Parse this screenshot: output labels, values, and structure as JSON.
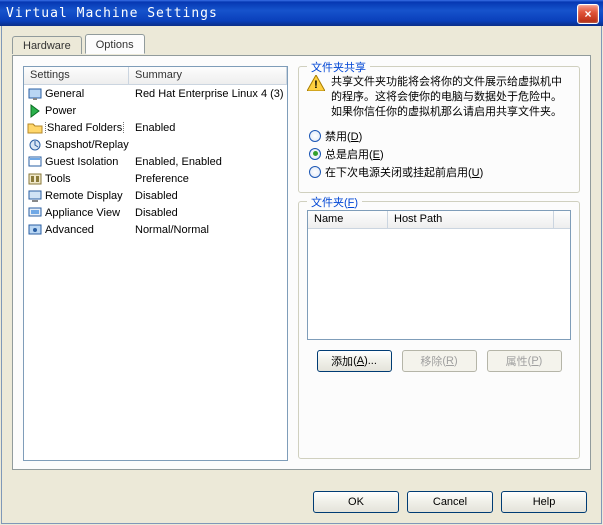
{
  "window": {
    "title": "Virtual Machine Settings",
    "close_icon": "×"
  },
  "tabs": {
    "hardware": "Hardware",
    "options": "Options",
    "active": "options"
  },
  "settings_list": {
    "header_settings": "Settings",
    "header_summary": "Summary",
    "rows": [
      {
        "icon": "general-icon",
        "label": "General",
        "summary": "Red Hat Enterprise Linux 4 (3)",
        "selected": false
      },
      {
        "icon": "power-icon",
        "label": "Power",
        "summary": "",
        "selected": false
      },
      {
        "icon": "folder-icon",
        "label": "Shared Folders",
        "summary": "Enabled",
        "selected": true
      },
      {
        "icon": "snapshot-icon",
        "label": "Snapshot/Replay",
        "summary": "",
        "selected": false
      },
      {
        "icon": "guest-isolation-icon",
        "label": "Guest Isolation",
        "summary": "Enabled, Enabled",
        "selected": false
      },
      {
        "icon": "tools-icon",
        "label": "Tools",
        "summary": "Preference",
        "selected": false
      },
      {
        "icon": "remote-display-icon",
        "label": "Remote Display",
        "summary": "Disabled",
        "selected": false
      },
      {
        "icon": "appliance-view-icon",
        "label": "Appliance View",
        "summary": "Disabled",
        "selected": false
      },
      {
        "icon": "advanced-icon",
        "label": "Advanced",
        "summary": "Normal/Normal",
        "selected": false
      }
    ]
  },
  "shared_folders_panel": {
    "group1_title": "文件夹共享",
    "warning_text": "共享文件夹功能将会将你的文件展示给虚拟机中的程序。这将会使你的电脑与数据处于危险中。如果你信任你的虚拟机那么请启用共享文件夹。",
    "radio_disabled": "禁用",
    "radio_disabled_hotkey": "D",
    "radio_always": "总是启用",
    "radio_always_hotkey": "E",
    "radio_until": "在下次电源关闭或挂起前启用",
    "radio_until_hotkey": "U",
    "selected_radio": "always",
    "group2_title": "文件夹",
    "group2_hotkey": "F",
    "col_name": "Name",
    "col_hostpath": "Host Path",
    "btn_add": "添加",
    "btn_add_hotkey": "A",
    "btn_remove": "移除",
    "btn_remove_hotkey": "R",
    "btn_props": "属性",
    "btn_props_hotkey": "P"
  },
  "dialog_buttons": {
    "ok": "OK",
    "cancel": "Cancel",
    "help": "Help"
  },
  "colors": {
    "titlebar_blue": "#1653cc",
    "close_red": "#e1553a",
    "group_label_blue": "#0046d5",
    "border_blue": "#7f9db9"
  }
}
